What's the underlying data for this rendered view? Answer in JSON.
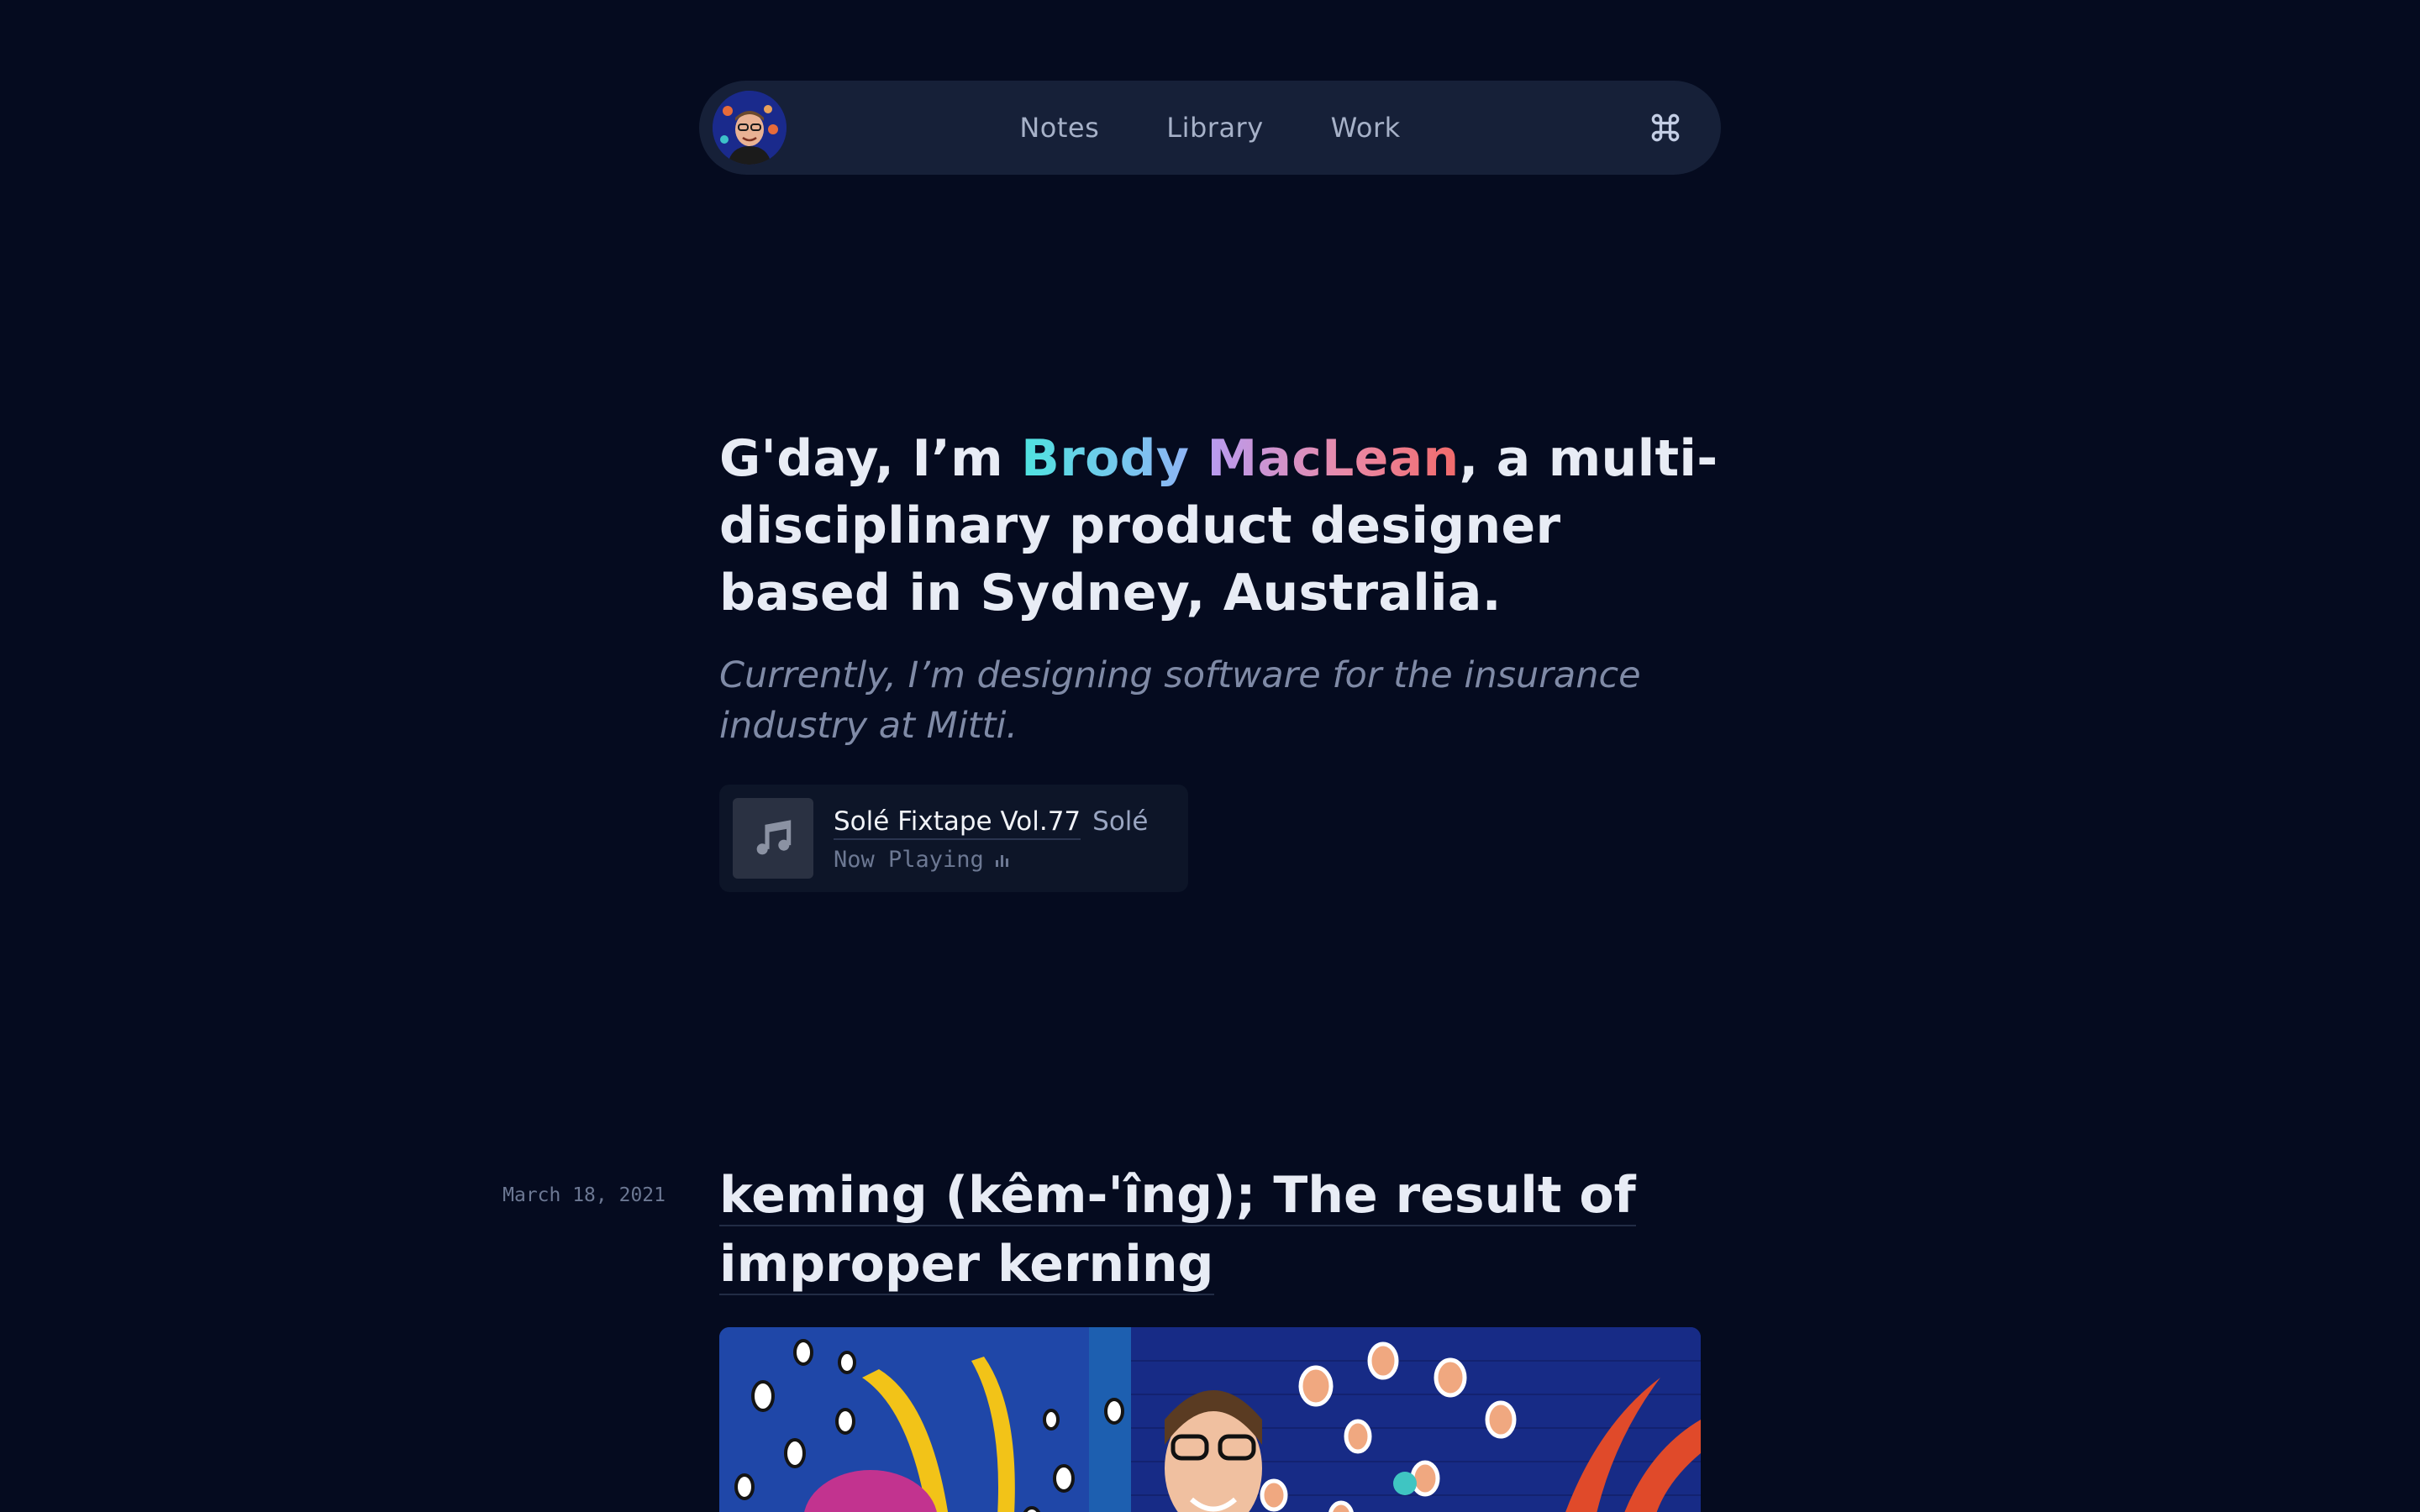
{
  "nav": {
    "links": [
      "Notes",
      "Library",
      "Work"
    ],
    "avatar_icon": "avatar",
    "command_icon": "command-icon"
  },
  "hero": {
    "greeting": "G'day, I’m ",
    "first_name": "Brody",
    "last_name": "MacLean",
    "rest": ", a multi-disciplinary product designer based in Sydney, Australia.",
    "subtitle": "Currently, I’m designing software for the insurance industry at Mitti."
  },
  "now_playing": {
    "track": "Solé Fixtape Vol.77",
    "artist": "Solé",
    "status": "Now Playing",
    "art_icon": "music-note-icon"
  },
  "post": {
    "date": "March 18, 2021",
    "title": "keming (kêm-'îng); The result of improper kerning"
  },
  "colors": {
    "background": "#050b1f",
    "nav_bg": "#162038",
    "first_name_gradient": [
      "#4fe3e0",
      "#8fb4f5"
    ],
    "last_name_gradient": [
      "#b79cf2",
      "#f26a6a"
    ]
  }
}
